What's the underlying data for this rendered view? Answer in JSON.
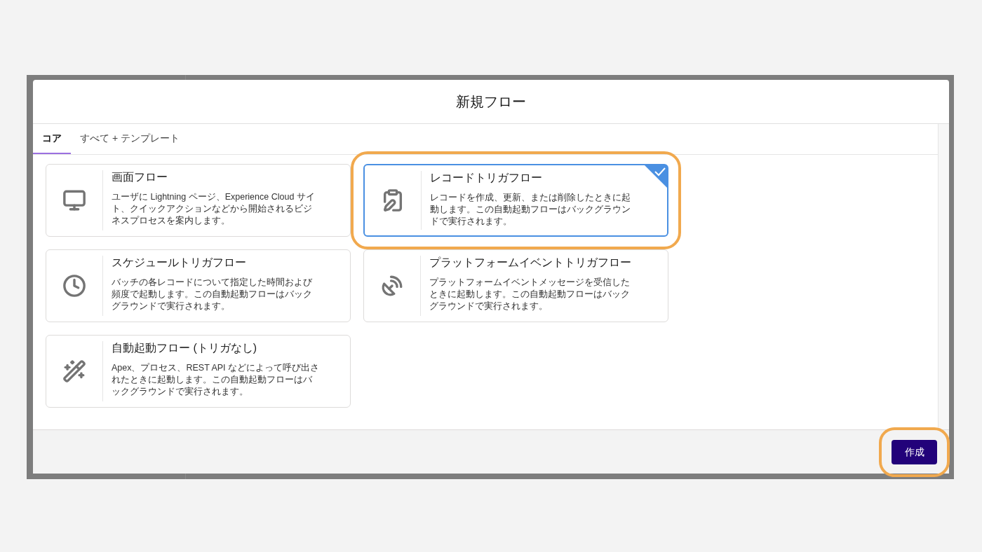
{
  "modal": {
    "title": "新規フロー",
    "tabs": [
      {
        "label": "コア",
        "selected": true
      },
      {
        "label": "すべて + テンプレート",
        "selected": false
      }
    ],
    "cards": [
      {
        "kind": "screen",
        "title": "画面フロー",
        "description": "ユーザに Lightning ページ、Experience Cloud サイト、クイックアクションなどから開始されるビジネスプロセスを案内します。",
        "selected": false,
        "highlighted": false
      },
      {
        "kind": "record",
        "title": "レコードトリガフロー",
        "description": "レコードを作成、更新、または削除したときに起動します。この自動起動フローはバックグラウンドで実行されます。",
        "selected": true,
        "highlighted": true
      },
      {
        "kind": "schedule",
        "title": "スケジュールトリガフロー",
        "description": "バッチの各レコードについて指定した時間および頻度で起動します。この自動起動フローはバックグラウンドで実行されます。",
        "selected": false,
        "highlighted": false
      },
      {
        "kind": "platform",
        "title": "プラットフォームイベントトリガフロー",
        "description": "プラットフォームイベントメッセージを受信したときに起動します。この自動起動フローはバックグラウンドで実行されます。",
        "selected": false,
        "highlighted": false
      },
      {
        "kind": "autolaunch",
        "title": "自動起動フロー (トリガなし)",
        "description": "Apex、プロセス、REST API などによって呼び出されたときに起動します。この自動起動フローはバックグラウンドで実行されます。",
        "selected": false,
        "highlighted": false
      }
    ],
    "create_button": {
      "label": "作成",
      "highlighted": true
    }
  }
}
